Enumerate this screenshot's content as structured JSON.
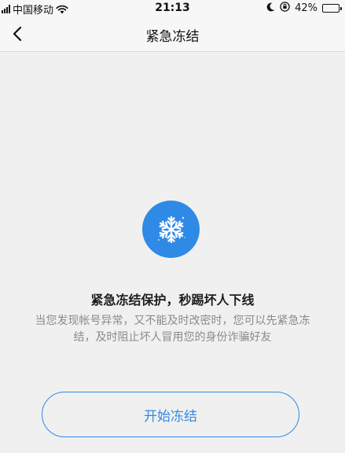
{
  "status_bar": {
    "carrier": "中国移动",
    "time": "21:13",
    "battery_percent": "42%",
    "battery_level": 0.42,
    "icons": [
      "signal-icon",
      "wifi-icon",
      "moon-icon",
      "orientation-lock-icon",
      "battery-icon"
    ]
  },
  "nav": {
    "back_icon": "chevron-left-icon",
    "title": "紧急冻结"
  },
  "main": {
    "icon": "snowflake-icon",
    "headline": "紧急冻结保护，秒踢坏人下线",
    "description": "当您发现帐号异常，又不能及时改密时，您可以先紧急冻结，及时阻止坏人冒用您的身份诈骗好友",
    "start_button": "开始冻结"
  },
  "colors": {
    "accent": "#2f8ae6",
    "background": "#f0f0f0",
    "muted_text": "#8a8a8a"
  }
}
